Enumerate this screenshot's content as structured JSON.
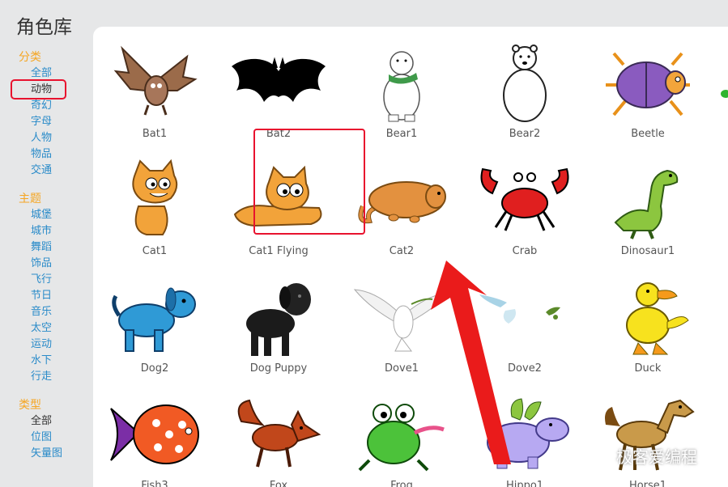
{
  "page_title": "角色库",
  "sidebar": {
    "category_title": "分类",
    "categories": [
      "全部",
      "动物",
      "奇幻",
      "字母",
      "人物",
      "物品",
      "交通"
    ],
    "theme_title": "主题",
    "themes": [
      "城堡",
      "城市",
      "舞蹈",
      "饰品",
      "飞行",
      "节日",
      "音乐",
      "太空",
      "运动",
      "水下",
      "行走"
    ],
    "type_title": "类型",
    "types": [
      "全部",
      "位图",
      "矢量图"
    ]
  },
  "sprites": [
    {
      "name": "Bat1",
      "icon": "bat1-icon"
    },
    {
      "name": "Bat2",
      "icon": "bat2-icon"
    },
    {
      "name": "Bear1",
      "icon": "bear1-icon"
    },
    {
      "name": "Bear2",
      "icon": "bear2-icon"
    },
    {
      "name": "Beetle",
      "icon": "beetle-icon"
    },
    {
      "name": "Cat1",
      "icon": "cat1-icon"
    },
    {
      "name": "Cat1 Flying",
      "icon": "cat1-flying-icon"
    },
    {
      "name": "Cat2",
      "icon": "cat2-icon"
    },
    {
      "name": "Crab",
      "icon": "crab-icon"
    },
    {
      "name": "Dinosaur1",
      "icon": "dinosaur1-icon"
    },
    {
      "name": "Dog2",
      "icon": "dog2-icon"
    },
    {
      "name": "Dog Puppy",
      "icon": "dog-puppy-icon"
    },
    {
      "name": "Dove1",
      "icon": "dove1-icon"
    },
    {
      "name": "Dove2",
      "icon": "dove2-icon"
    },
    {
      "name": "Duck",
      "icon": "duck-icon"
    },
    {
      "name": "Fish3",
      "icon": "fish3-icon"
    },
    {
      "name": "Fox",
      "icon": "fox-icon"
    },
    {
      "name": "Frog",
      "icon": "frog-icon"
    },
    {
      "name": "Hippo1",
      "icon": "hippo1-icon"
    },
    {
      "name": "Horse1",
      "icon": "horse1-icon"
    }
  ],
  "watermark": "极客爱编程",
  "colors": {
    "accent": "#f5a623",
    "link": "#2a8bc9",
    "highlight": "#e8122e"
  }
}
